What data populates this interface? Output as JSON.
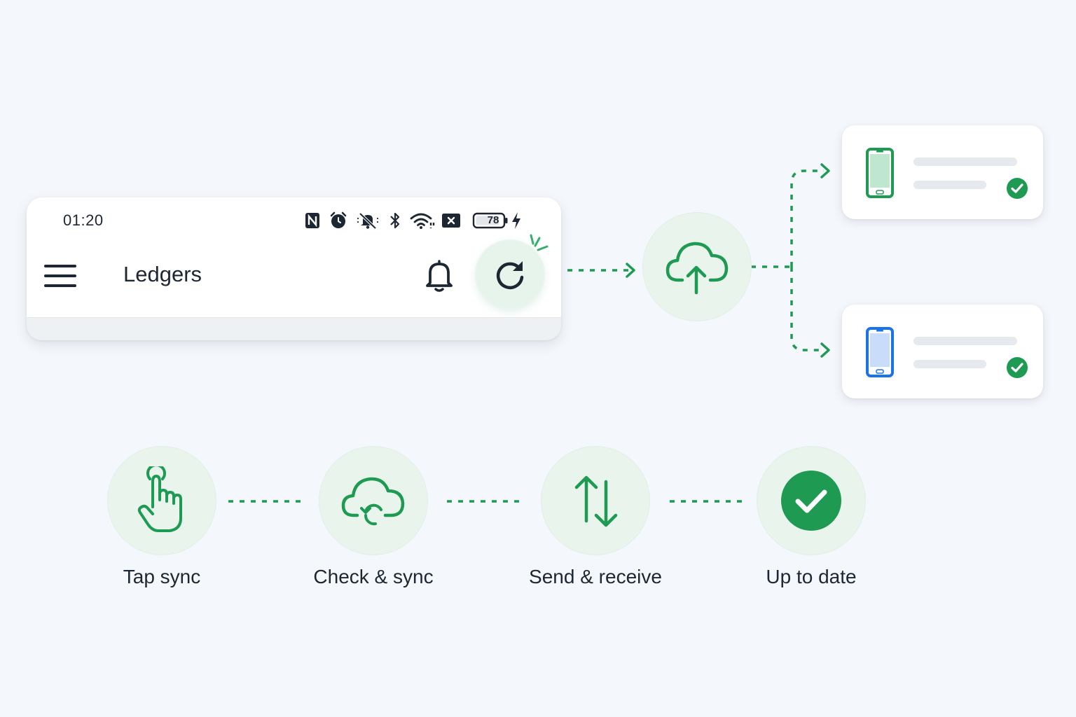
{
  "status_bar": {
    "time": "01:20",
    "battery_level": "78",
    "icons": [
      "nfc-icon",
      "alarm-icon",
      "bell-off-icon",
      "bluetooth-icon",
      "wifi-icon",
      "no-sim-icon",
      "battery-icon",
      "charging-icon"
    ]
  },
  "app_bar": {
    "title": "Ledgers",
    "actions": [
      "menu-icon",
      "bell-icon",
      "sync-icon"
    ]
  },
  "hub": {
    "icon": "cloud-upload-icon"
  },
  "devices": [
    {
      "icon": "phone-icon",
      "color": "#1e9a52",
      "status": "check-circle-icon"
    },
    {
      "icon": "phone-icon",
      "color": "#1a73e8",
      "status": "check-circle-icon"
    }
  ],
  "steps": [
    {
      "label": "Tap sync",
      "icon": "tap-hand-icon"
    },
    {
      "label": "Check & sync",
      "icon": "cloud-sync-icon"
    },
    {
      "label": "Send & receive",
      "icon": "arrows-up-down-icon"
    },
    {
      "label": "Up to date",
      "icon": "check-circle-icon"
    }
  ],
  "colors": {
    "accent": "#1e9a52",
    "accent_light": "#e8f4ec",
    "device_blue": "#1a73e8",
    "background": "#f4f7fb"
  }
}
